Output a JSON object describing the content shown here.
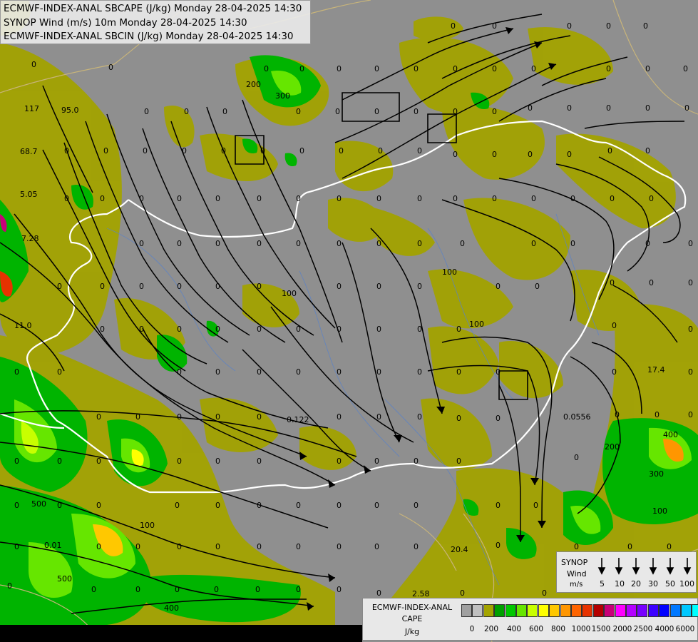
{
  "titles": [
    "ECMWF-INDEX-ANAL SBCAPE (J/kg) Monday 28-04-2025 14:30",
    "SYNOP Wind (m/s) 10m Monday 28-04-2025 14:30",
    "ECMWF-INDEX-ANAL SBCIN (J/kg) Monday 28-04-2025 14:30"
  ],
  "map_labels": [
    {
      "text": "0"
    },
    {
      "text": "117"
    },
    {
      "text": "95.0"
    },
    {
      "text": "100"
    },
    {
      "text": "200"
    },
    {
      "text": "300"
    },
    {
      "text": "68.7"
    },
    {
      "text": "5.05"
    },
    {
      "text": "7.28"
    },
    {
      "text": "11.0"
    },
    {
      "text": "0.122"
    },
    {
      "text": "0.0556"
    },
    {
      "text": "17.4"
    },
    {
      "text": "400"
    },
    {
      "text": "0.01"
    },
    {
      "text": "2.58"
    },
    {
      "text": "20.4"
    },
    {
      "text": "500"
    }
  ],
  "synop_legend": {
    "title": "SYNOP",
    "sub": "Wind",
    "unit": "m/s",
    "values": [
      "5",
      "10",
      "20",
      "30",
      "50",
      "100"
    ]
  },
  "cape_legend": {
    "title1": "ECMWF-INDEX-ANAL",
    "title2": "CAPE",
    "unit": "J/kg",
    "ticks": [
      "0",
      "200",
      "400",
      "600",
      "800",
      "1000",
      "1500",
      "2000",
      "2500",
      "4000",
      "6000"
    ],
    "colors": [
      "#a0a0a0",
      "#c0c0c0",
      "#a4a400",
      "#00a000",
      "#00c800",
      "#66e600",
      "#c8ff00",
      "#ffff00",
      "#ffc800",
      "#ff9600",
      "#ff6400",
      "#e63200",
      "#b40000",
      "#c80078",
      "#ff00ff",
      "#b400ff",
      "#7800ff",
      "#3c00ff",
      "#0000ff",
      "#0078ff",
      "#00c8ff",
      "#00ffff",
      "#96ffff",
      "#ffffff"
    ]
  },
  "colors": {
    "background": "#8f8f8f",
    "olive": "#a3a300",
    "border": "#ffffff",
    "streamline": "#000000"
  }
}
